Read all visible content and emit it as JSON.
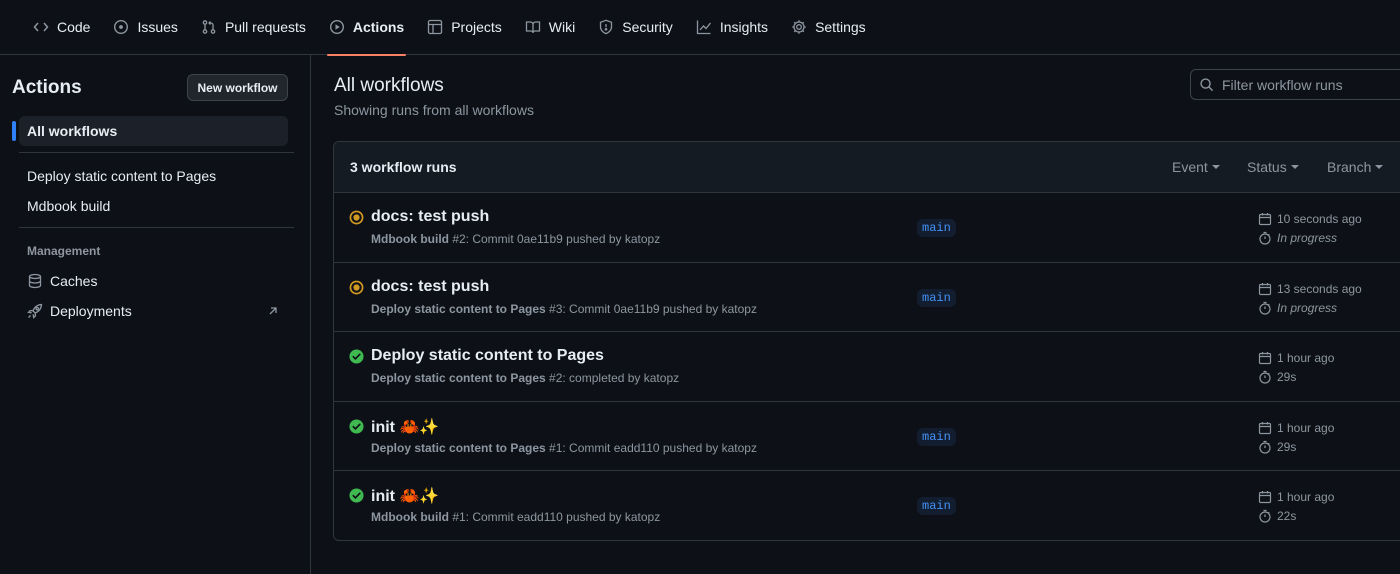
{
  "nav": {
    "tabs": [
      {
        "label": "Code",
        "icon": "code-icon"
      },
      {
        "label": "Issues",
        "icon": "issue-opened-icon"
      },
      {
        "label": "Pull requests",
        "icon": "git-pull-request-icon"
      },
      {
        "label": "Actions",
        "icon": "play-icon",
        "active": true
      },
      {
        "label": "Projects",
        "icon": "table-icon"
      },
      {
        "label": "Wiki",
        "icon": "book-icon"
      },
      {
        "label": "Security",
        "icon": "shield-icon"
      },
      {
        "label": "Insights",
        "icon": "graph-icon"
      },
      {
        "label": "Settings",
        "icon": "gear-icon"
      }
    ]
  },
  "sidebar": {
    "title": "Actions",
    "new_workflow_label": "New workflow",
    "all_workflows_label": "All workflows",
    "workflows": [
      "Deploy static content to Pages",
      "Mdbook build"
    ],
    "management_heading": "Management",
    "management_items": [
      {
        "label": "Caches",
        "icon": "database-icon"
      },
      {
        "label": "Deployments",
        "icon": "rocket-icon",
        "external": true
      }
    ]
  },
  "main": {
    "title": "All workflows",
    "subtitle": "Showing runs from all workflows",
    "filter_placeholder": "Filter workflow runs",
    "runs_count": "3 workflow runs",
    "filters": [
      "Event",
      "Status",
      "Branch"
    ],
    "runs": [
      {
        "status": "in_progress",
        "title": "docs: test push",
        "workflow": "Mdbook build",
        "meta": " #2: Commit 0ae11b9 pushed by katopz",
        "branch": "main",
        "when": "10 seconds ago",
        "duration": "In progress"
      },
      {
        "status": "in_progress",
        "title": "docs: test push",
        "workflow": "Deploy static content to Pages",
        "meta": " #3: Commit 0ae11b9 pushed by katopz",
        "branch": "main",
        "when": "13 seconds ago",
        "duration": "In progress"
      },
      {
        "status": "success",
        "title": "Deploy static content to Pages",
        "workflow": "Deploy static content to Pages",
        "meta": " #2: completed by katopz",
        "branch": "",
        "when": "1 hour ago",
        "duration": "29s"
      },
      {
        "status": "success",
        "title": "init 🦀✨",
        "workflow": "Deploy static content to Pages",
        "meta": " #1: Commit eadd110 pushed by katopz",
        "branch": "main",
        "when": "1 hour ago",
        "duration": "29s"
      },
      {
        "status": "success",
        "title": "init 🦀✨",
        "workflow": "Mdbook build",
        "meta": " #1: Commit eadd110 pushed by katopz",
        "branch": "main",
        "when": "1 hour ago",
        "duration": "22s"
      }
    ]
  },
  "colors": {
    "background": "#0d1117",
    "accent_tab": "#f78166",
    "selected_marker": "#2f81f7",
    "in_progress": "#d29922",
    "success": "#3fb950",
    "branch_text": "#4493f8"
  }
}
